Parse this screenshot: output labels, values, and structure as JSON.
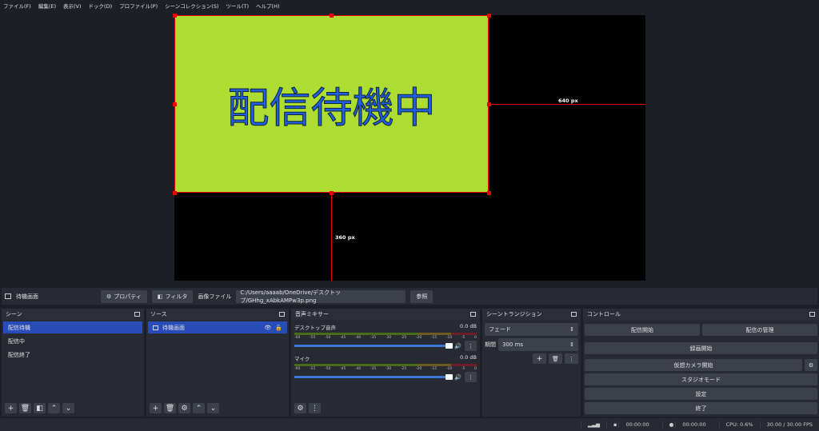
{
  "menu": [
    "ファイル(F)",
    "編集(E)",
    "表示(V)",
    "ドック(D)",
    "プロファイル(P)",
    "シーンコレクション(S)",
    "ツール(T)",
    "ヘルプ(H)"
  ],
  "preview": {
    "image_text": "配信待機中",
    "width_label": "640 px",
    "height_label": "360 px",
    "image_color": "#addc33",
    "text_color": "#1f5fe0"
  },
  "source_bar": {
    "name": "待機画面",
    "properties": "プロパティ",
    "filters": "フィルタ",
    "file_label": "画像ファイル",
    "file_path": "C:/Users/aaaab/OneDrive/デスクトップ/GHhg_xAbkAMPw3p.png",
    "browse": "参照"
  },
  "scenes": {
    "title": "シーン",
    "items": [
      "配信待機",
      "配信中",
      "配信終了"
    ]
  },
  "sources": {
    "title": "ソース",
    "items": [
      "待機画面"
    ]
  },
  "mixer": {
    "title": "音声ミキサー",
    "ticks": [
      "-60",
      "-55",
      "-50",
      "-45",
      "-40",
      "-35",
      "-30",
      "-25",
      "-20",
      "-15",
      "-10",
      "-5",
      "0"
    ],
    "channels": [
      {
        "name": "デスクトップ音声",
        "level": "0.0 dB",
        "volume": 1.0
      },
      {
        "name": "マイク",
        "level": "0.0 dB",
        "volume": 1.0
      }
    ]
  },
  "transitions": {
    "title": "シーントランジション",
    "type": "フェード",
    "duration_label": "期間",
    "duration": "300 ms"
  },
  "controls": {
    "title": "コントロール",
    "start_stream": "配信開始",
    "manage_stream": "配信の管理",
    "start_record": "録画開始",
    "virtual_cam": "仮想カメラ開始",
    "studio_mode": "スタジオモード",
    "settings": "設定",
    "exit": "終了"
  },
  "status": {
    "stream_time": "00:00:00",
    "record_time": "00:00:00",
    "cpu": "CPU: 0.6%",
    "fps": "30.00 / 30.00 FPS"
  }
}
